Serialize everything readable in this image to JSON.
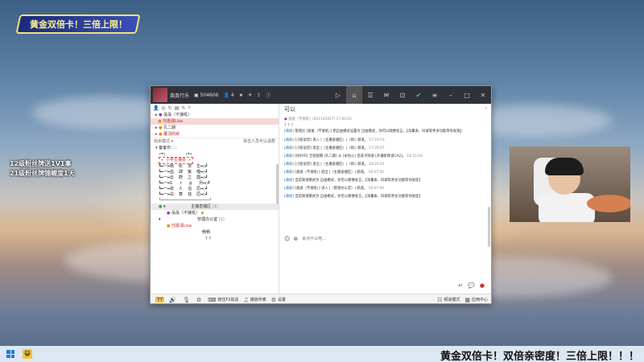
{
  "banner": {
    "text": "黄金双倍卡！三倍上限！"
  },
  "side_overlay": {
    "line1": "12级粉丝牌送1V1事",
    "line2": "21级粉丝牌锦鲤度1天"
  },
  "window": {
    "title": "彘彘行乐",
    "channel_id": "504606",
    "online_count": "4",
    "chat_title": "可以",
    "input_placeholder": "说点什么吧..."
  },
  "tree": [
    {
      "label": "彘彘（不接吼）",
      "selected": false
    },
    {
      "label": "刘嘉译Lisa",
      "selected": true
    },
    {
      "label": "孔二朗",
      "selected": false
    },
    {
      "label": "董羽的欲",
      "selected": false
    }
  ],
  "section": {
    "label": "双余模式 ▾",
    "right": "单击人员可以进群"
  },
  "group_title": "▾ 备备份：：：",
  "ascii_art": {
    "top": "┌★┐        ┌★┐",
    "box": "✕ 小学主播会 ✕",
    "rows": [
      "┗━一━杨  纶  求  生━○┛",
      "┗━一━血  肆  紫  噬━○┛",
      "┗━一━云  蔚  之  霞━○┛",
      "┗━一━S   r   @   月━○┛",
      "┗━一━泉  人  浴  厄━○┛",
      "┗━一━白  算  找  厄━○┛"
    ],
    "bottom": "└────────────────────┘"
  },
  "lobby": [
    {
      "label": "主播直播区",
      "count": "(1)"
    },
    {
      "label": "彘彘（不接吼）",
      "count": ""
    },
    {
      "label": "管理办公室",
      "count": "(1)"
    },
    {
      "label": "刘嘉译Lisa",
      "count": ""
    },
    {
      "label": "畅畅",
      "count": ""
    },
    {
      "label": "? ?",
      "count": ""
    }
  ],
  "messages": [
    {
      "who": "彘彘（不接吼）(831145457)",
      "time": "17:04:05",
      "text": "？？？"
    },
    {
      "tag": "[通知]",
      "text": "管理员 [彘彘（不接吼）] 把自由模式设置为 自由模式，你可以随便发言。【海量表、同城等更多功能等你发现】",
      "time": ""
    },
    {
      "tag": "[通知]",
      "text": "[小船说话] 进入 |（主播直播区）|（抑:| 频道。",
      "time": "17:19:53"
    },
    {
      "tag": "[通知]",
      "text": "[小船说话] 退出 |（主播直播区）|（抑:| 频道。",
      "time": "17:20:07"
    },
    {
      "tag": "[通知]",
      "text": "[你好吗] 全程观察 [孔二朗] 从 [永恒火] 变成子频道 [开播新频道CA2]。",
      "time": "18:15:03"
    },
    {
      "tag": "[通知]",
      "text": "[小船说话] 退出 |（主播直播区）|（抑:| 频道。",
      "time": "18:25:01"
    },
    {
      "tag": "[通知]",
      "text": "[彘彘（不接吼）] 退出 |（主播直播区）| 频道。",
      "time": "19:47:42"
    },
    {
      "tag": "[通知]",
      "text": "当前频道模式为 自由模式，你可以随便发言。【海量表、同城等更多功能等你发现】",
      "time": ""
    },
    {
      "tag": "[通知]",
      "text": "[彘彘（不接吼）] 进入 |（管理办公室）| 频道。",
      "time": "19:47:00"
    },
    {
      "tag": "[通知]",
      "text": "当前频道模式为 自由模式，你可以随便发言。【海量表、同城等更多功能等你发现】",
      "time": ""
    }
  ],
  "bottombar": {
    "hint": "按住F2说话",
    "record": "播放伴奏",
    "settings": "设置",
    "mode": "频道模式",
    "app_center": "应用中心"
  },
  "marquee": "黄金双倍卡！双倍亲密度！三倍上限！！！"
}
